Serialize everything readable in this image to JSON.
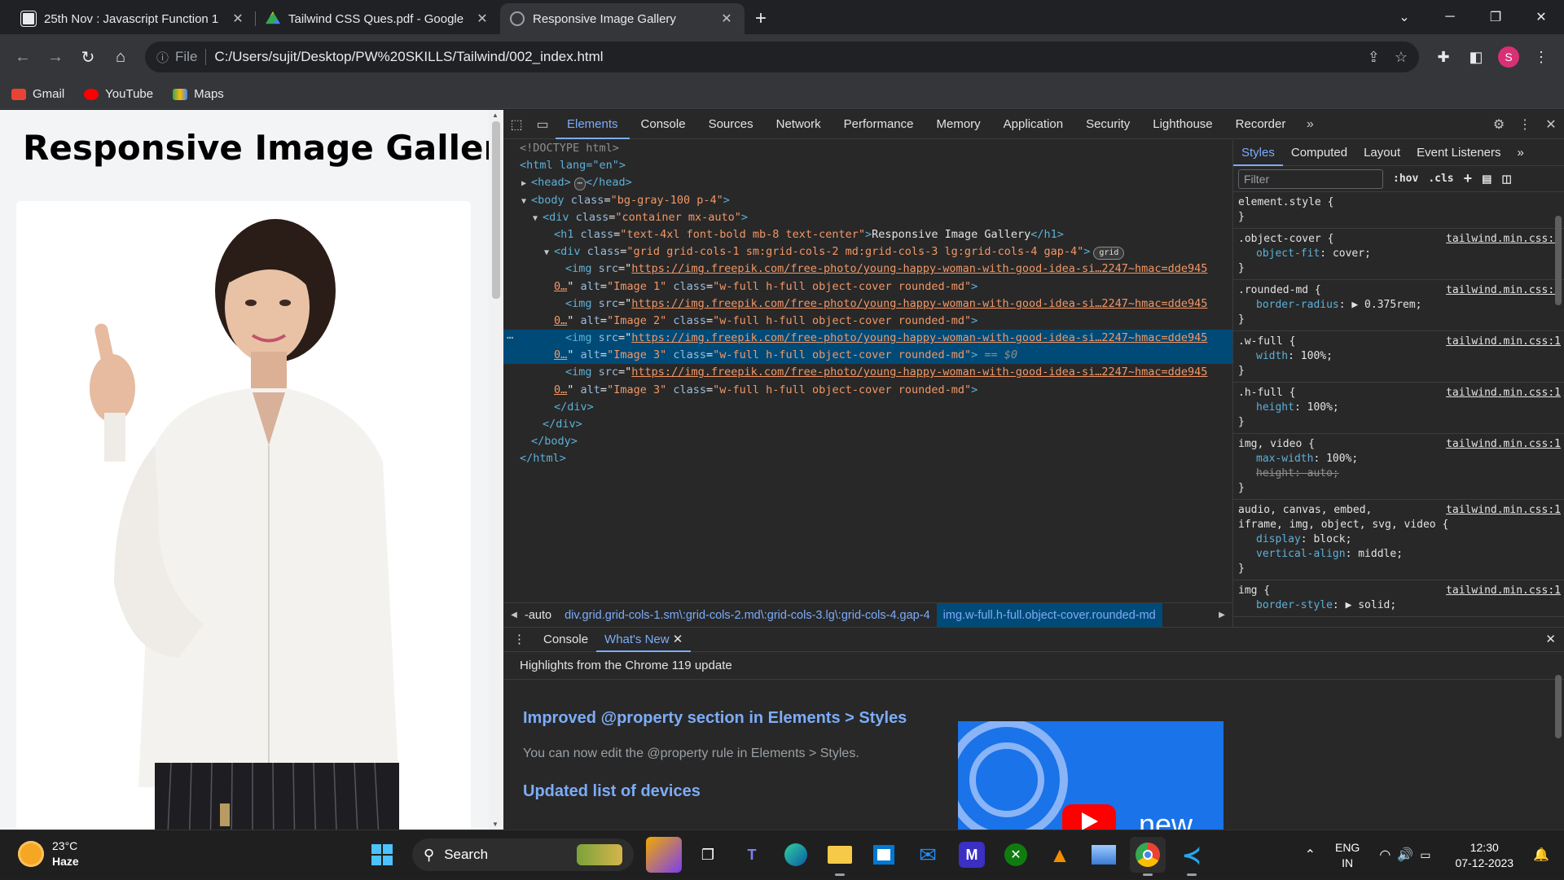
{
  "tabs": [
    {
      "title": "25th Nov : Javascript Function 1",
      "fav_color": "#e8eaed"
    },
    {
      "title": "Tailwind CSS Ques.pdf - Google",
      "fav_color": "#34a853"
    },
    {
      "title": "Responsive Image Gallery",
      "fav_color": "#9aa0a6"
    }
  ],
  "omnibox": {
    "scheme": "File",
    "url": "C:/Users/sujit/Desktop/PW%20SKILLS/Tailwind/002_index.html"
  },
  "profile_initial": "S",
  "bookmarks": [
    {
      "label": "Gmail",
      "color": "#ea4335"
    },
    {
      "label": "YouTube",
      "color": "#ff0000"
    },
    {
      "label": "Maps",
      "color": "#34a853"
    }
  ],
  "page": {
    "heading": "Responsive Image Gallery"
  },
  "devtools": {
    "tabs": [
      "Elements",
      "Console",
      "Sources",
      "Network",
      "Performance",
      "Memory",
      "Application",
      "Security",
      "Lighthouse",
      "Recorder"
    ],
    "active_tab": "Elements",
    "dom": {
      "doctype": "<!DOCTYPE html>",
      "html_open": "<html lang=\"en\">",
      "head": "<head>",
      "head_close": "</head>",
      "body_tag": "body",
      "body_class_attr": "class",
      "body_class": "\"bg-gray-100 p-4\"",
      "div1_class": "\"container mx-auto\"",
      "h1_class": "\"text-4xl font-bold mb-8 text-center\"",
      "h1_text": "Responsive Image Gallery",
      "grid_class": "\"grid grid-cols-1 sm:grid-cols-2 md:grid-cols-3 lg:grid-cols-4 gap-4\"",
      "grid_badge": "grid",
      "img_src": "https://img.freepik.com/free-photo/young-happy-woman-with-good-idea-si…2247~hmac=dde945",
      "img_src_tail": "0…",
      "img_class": "\"w-full h-full object-cover rounded-md\"",
      "img_alts": [
        "\"Image 1\"",
        "\"Image 2\"",
        "\"Image 3\"",
        "\"Image 3\""
      ],
      "selected_marker": "== $0",
      "div_close": "</div>",
      "body_close": "</body>",
      "html_close": "</html>"
    },
    "breadcrumbs": [
      "-auto",
      "div.grid.grid-cols-1.sm\\:grid-cols-2.md\\:grid-cols-3.lg\\:grid-cols-4.gap-4",
      "img.w-full.h-full.object-cover.rounded-md"
    ],
    "styles": {
      "tabs": [
        "Styles",
        "Computed",
        "Layout",
        "Event Listeners"
      ],
      "filter_placeholder": "Filter",
      "hov": ":hov",
      "cls": ".cls",
      "source": "tailwind.min.css:1",
      "rules": [
        {
          "selector": "element.style {",
          "props": [],
          "src": ""
        },
        {
          "selector": ".object-cover {",
          "props": [
            {
              "n": "object-fit",
              "v": "cover;"
            }
          ],
          "src": "tailwind.min.css:1"
        },
        {
          "selector": ".rounded-md {",
          "props": [
            {
              "n": "border-radius",
              "v": "▶ 0.375rem;"
            }
          ],
          "src": "tailwind.min.css:1"
        },
        {
          "selector": ".w-full {",
          "props": [
            {
              "n": "width",
              "v": "100%;"
            }
          ],
          "src": "tailwind.min.css:1"
        },
        {
          "selector": ".h-full {",
          "props": [
            {
              "n": "height",
              "v": "100%;"
            }
          ],
          "src": "tailwind.min.css:1"
        },
        {
          "selector": "img, video {",
          "props": [
            {
              "n": "max-width",
              "v": "100%;"
            },
            {
              "n": "height",
              "v": "auto;",
              "strike": true
            }
          ],
          "src": "tailwind.min.css:1"
        },
        {
          "selector": "audio, canvas, embed,",
          "selector2": "iframe, img, object, svg, video {",
          "props": [
            {
              "n": "display",
              "v": "block;"
            },
            {
              "n": "vertical-align",
              "v": "middle;"
            }
          ],
          "src": "tailwind.min.css:1"
        },
        {
          "selector": "img {",
          "props": [
            {
              "n": "border-style",
              "v": "▶ solid;"
            }
          ],
          "src": "tailwind.min.css:1"
        }
      ]
    },
    "drawer": {
      "tabs": [
        "Console",
        "What's New"
      ],
      "active_tab": "What's New",
      "highlight": "Highlights from the Chrome 119 update",
      "h1": "Improved @property section in Elements > Styles",
      "p1": "You can now edit the @property rule in Elements > Styles.",
      "h2": "Updated list of devices",
      "video_text": "new"
    }
  },
  "taskbar": {
    "weather_temp": "23°C",
    "weather_cond": "Haze",
    "search": "Search",
    "lang1": "ENG",
    "lang2": "IN",
    "time": "12:30",
    "date": "07-12-2023"
  }
}
